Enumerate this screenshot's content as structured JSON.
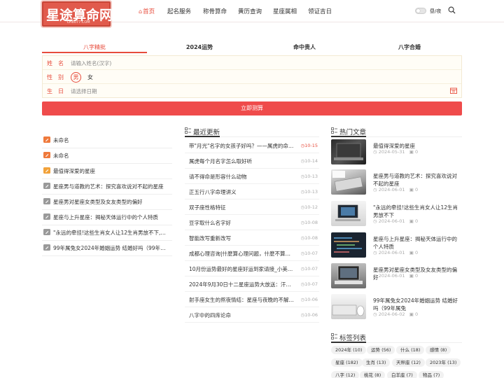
{
  "logo": {
    "text": "星途算命网",
    "sub": "LH8077.COM"
  },
  "nav": [
    {
      "label": "首页"
    },
    {
      "label": "起名服务"
    },
    {
      "label": "称骨算命"
    },
    {
      "label": "黄历查询"
    },
    {
      "label": "星座属相"
    },
    {
      "label": "领证吉日"
    }
  ],
  "theme_label": "昼/夜",
  "tabs": [
    {
      "label": "八字精批"
    },
    {
      "label": "2024运势"
    },
    {
      "label": "命中贵人"
    },
    {
      "label": "八字合婚"
    }
  ],
  "form": {
    "name_label": "姓　名",
    "name_placeholder": "请输入姓名(汉字)",
    "gender_label": "性　别",
    "gender_male": "男",
    "gender_female": "女",
    "date_label": "生　日",
    "date_placeholder": "请选择日期",
    "submit": "立即测算"
  },
  "left_list": [
    {
      "text": "未命名"
    },
    {
      "text": "未命名"
    },
    {
      "text": "最值得深爱的星座"
    },
    {
      "text": "星座男与道教的艺术：探究喜欢说对不起的星座"
    },
    {
      "text": "星座男对星座女类型及女友类型的偏好"
    },
    {
      "text": "星座与上升星座：揭秘天体运行中的个人特质"
    },
    {
      "text": "\"永远的牵挂!这些生肖女人让12生肖男放不下,他们..."
    },
    {
      "text": "99年属兔女2024年婚姻运势 结婚好吗（99年属兔..."
    }
  ],
  "recent": {
    "title": "最近更新",
    "items": [
      {
        "text": "带\"月光\"名字的女孩子好吗？——属虎的命运...",
        "date": "10-15"
      },
      {
        "text": "属虎每个月名字怎么取好听",
        "date": "10-14"
      },
      {
        "text": "请不得命是形容什么动物",
        "date": "10-13"
      },
      {
        "text": "正五行八字命理讲义",
        "date": "10-13"
      },
      {
        "text": "双子座性格特征",
        "date": "10-12"
      },
      {
        "text": "豆字取什么名字好",
        "date": "10-08"
      },
      {
        "text": "智能改写重新改写",
        "date": "10-08"
      },
      {
        "text": "成都心理咨询|什麼算心理问题，什麼不算心...",
        "date": "10-07"
      },
      {
        "text": "10月份运势最好的星座好运到家请接_小美_...",
        "date": "10-07"
      },
      {
        "text": "2024年9月30日十二星座运势大放送：汗水...",
        "date": "10-07"
      },
      {
        "text": "射手座女生的熬夜情结：星座与夜晚的不解...",
        "date": "10-06"
      },
      {
        "text": "八字中的四库论命",
        "date": "10-06"
      }
    ]
  },
  "hot": {
    "title": "热门文章",
    "items": [
      {
        "title": "最值得深爱的星座",
        "date": "2024-05-31",
        "count": "0"
      },
      {
        "title": "星座男与道教的艺术：探究喜欢说对不起的星座",
        "date": "2024-06-01",
        "count": "0"
      },
      {
        "title": "\"永远的牵挂!这些生肖女人让12生肖男放不下",
        "date": "2024-06-01",
        "count": "0"
      },
      {
        "title": "星座与上升星座：揭秘天体运行中的个人特质",
        "date": "2024-06-01",
        "count": "0"
      },
      {
        "title": "星座男对星座女类型及女友类型的偏好",
        "date": "2024-06-01",
        "count": "0"
      },
      {
        "title": "99年属兔女2024年婚姻运势 结婚好吗（99年属兔",
        "date": "2024-06-02",
        "count": "0"
      }
    ]
  },
  "tags": {
    "title": "标签列表",
    "items": [
      {
        "label": "2024年 (10)"
      },
      {
        "label": "运势 (56)"
      },
      {
        "label": "什么 (18)"
      },
      {
        "label": "感情 (8)"
      },
      {
        "label": "星座 (182)"
      },
      {
        "label": "生肖 (13)"
      },
      {
        "label": "天秤座 (12)"
      },
      {
        "label": "2023年 (13)"
      },
      {
        "label": "八字 (12)"
      },
      {
        "label": "桃花 (8)"
      },
      {
        "label": "白羊座 (7)"
      },
      {
        "label": "物品 (7)"
      }
    ]
  },
  "colors": {
    "accent": "#e74c3c",
    "button": "#ef4b4b"
  }
}
